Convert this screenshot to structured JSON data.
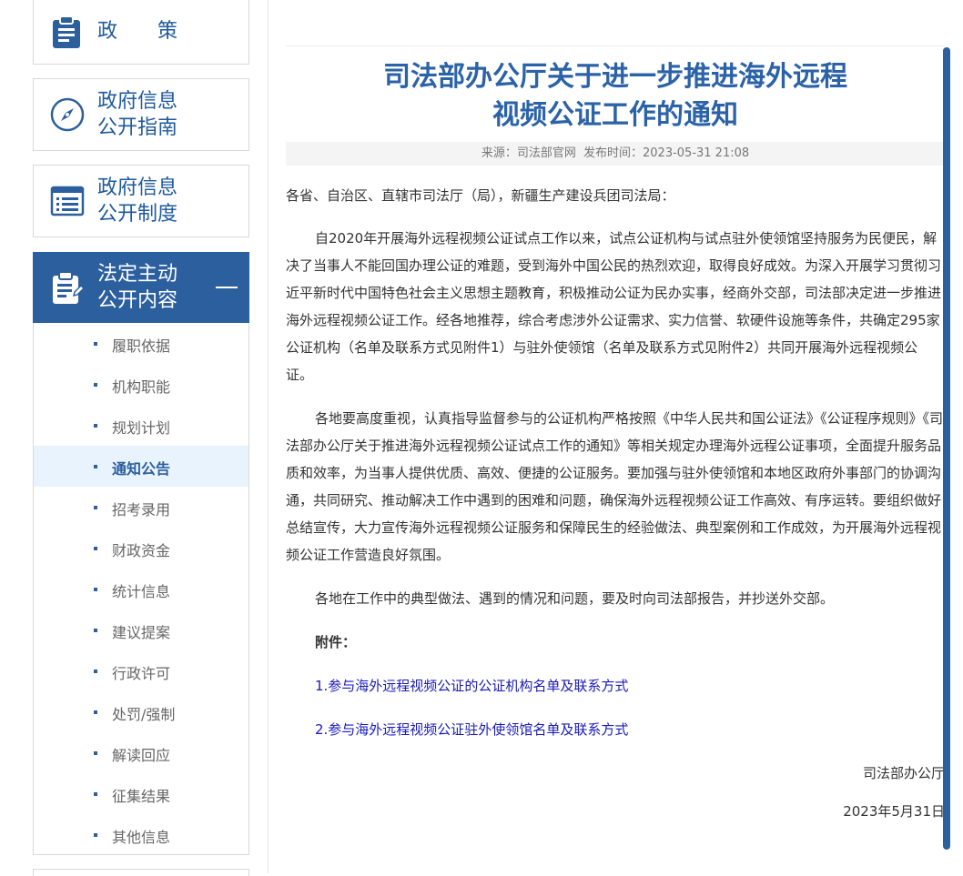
{
  "sidebar": {
    "cards": {
      "policy": "政　　策",
      "guide_line1": "政府信息",
      "guide_line2": "公开指南",
      "system_line1": "政府信息",
      "system_line2": "公开制度",
      "active_line1": "法定主动",
      "active_line2": "公开内容"
    },
    "items": [
      {
        "label": "履职依据"
      },
      {
        "label": "机构职能"
      },
      {
        "label": "规划计划"
      },
      {
        "label": "通知公告"
      },
      {
        "label": "招考录用"
      },
      {
        "label": "财政资金"
      },
      {
        "label": "统计信息"
      },
      {
        "label": "建议提案"
      },
      {
        "label": "行政许可"
      },
      {
        "label": "处罚/强制"
      },
      {
        "label": "解读回应"
      },
      {
        "label": "征集结果"
      },
      {
        "label": "其他信息"
      }
    ],
    "active_item": "通知公告",
    "icons": [
      "clipboard-icon",
      "compass-icon",
      "list-window-icon",
      "document-edit-icon"
    ]
  },
  "article": {
    "title_line1": "司法部办公厅关于进一步推进海外远程",
    "title_line2": "视频公证工作的通知",
    "source": "来源：司法部官网",
    "published": "发布时间：2023-05-31 21:08",
    "salutation": "各省、自治区、直辖市司法厅（局），新疆生产建设兵团司法局：",
    "paragraphs": [
      "自2020年开展海外远程视频公证试点工作以来，试点公证机构与试点驻外使领馆坚持服务为民便民，解决了当事人不能回国办理公证的难题，受到海外中国公民的热烈欢迎，取得良好成效。为深入开展学习贯彻习近平新时代中国特色社会主义思想主题教育，积极推动公证为民办实事，经商外交部，司法部决定进一步推进海外远程视频公证工作。经各地推荐，综合考虑涉外公证需求、实力信誉、软硬件设施等条件，共确定295家公证机构（名单及联系方式见附件1）与驻外使领馆（名单及联系方式见附件2）共同开展海外远程视频公证。",
      "各地要高度重视，认真指导监督参与的公证机构严格按照《中华人民共和国公证法》《公证程序规则》《司法部办公厅关于推进海外远程视频公证试点工作的通知》等相关规定办理海外远程公证事项，全面提升服务品质和效率，为当事人提供优质、高效、便捷的公证服务。要加强与驻外使领馆和本地区政府外事部门的协调沟通，共同研究、推动解决工作中遇到的困难和问题，确保海外远程视频公证工作高效、有序运转。要组织做好总结宣传，大力宣传海外远程视频公证服务和保障民生的经验做法、典型案例和工作成效，为开展海外远程视频公证工作营造良好氛围。",
      "各地在工作中的典型做法、遇到的情况和问题，要及时向司法部报告，并抄送外交部。"
    ],
    "attachments_heading": "附件：",
    "attachments": [
      "1.参与海外远程视频公证的公证机构名单及联系方式",
      "2.参与海外远程视频公证驻外使领馆名单及联系方式"
    ],
    "signature": "司法部办公厅",
    "date": "2023年5月31日"
  },
  "colors": {
    "accent": "#2c5f9e",
    "title": "#2b62a8",
    "link": "#1a1ab8",
    "active_item_bg": "#e8f3fd"
  }
}
